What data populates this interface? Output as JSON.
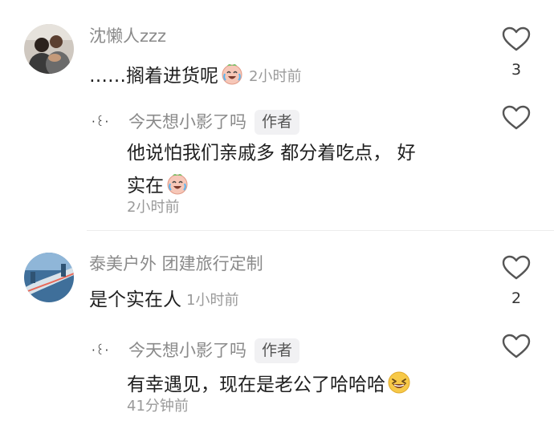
{
  "comments": [
    {
      "username": "沈懒人zzz",
      "text": "……搁着进货呢",
      "time": "2小时前",
      "likes": "3",
      "emoji": "crying-laughing-icon"
    },
    {
      "username": "泰美户外 团建旅行定制",
      "text": "是个实在人",
      "time": "1小时前",
      "likes": "2"
    }
  ],
  "replies": [
    {
      "avatar_text": "·꒰·",
      "username": "今天想小影了吗",
      "badge": "作者",
      "text_line1": "他说怕我们亲戚多 都分着吃点， 好",
      "text_line2": "实在",
      "time": "2小时前",
      "emoji": "crying-laughing-icon"
    },
    {
      "avatar_text": "·꒰·",
      "username": "今天想小影了吗",
      "badge": "作者",
      "text_line1": "有幸遇见，现在是老公了哈哈哈",
      "time": "41分钟前",
      "emoji": "grinning-squint-icon"
    }
  ],
  "colors": {
    "username": "#8a8a8a",
    "text": "#1f1f1f",
    "time": "#9a9a9a",
    "badge_bg": "#f1f1f3",
    "heart_stroke": "#555555"
  }
}
